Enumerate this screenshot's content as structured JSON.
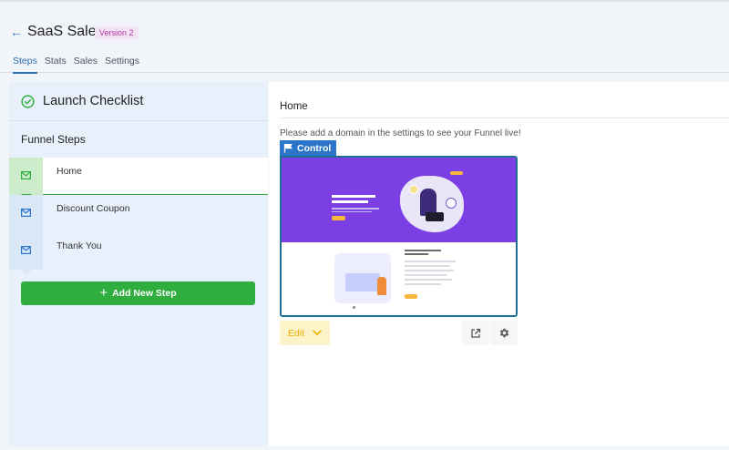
{
  "header": {
    "back_icon": "arrow-left-icon",
    "title": "SaaS Sales",
    "version_badge": "Version 2",
    "tabs": [
      {
        "label": "Steps",
        "active": true
      },
      {
        "label": "Stats",
        "active": false
      },
      {
        "label": "Sales",
        "active": false
      },
      {
        "label": "Settings",
        "active": false
      }
    ]
  },
  "sidebar": {
    "checklist_title": "Launch Checklist",
    "checklist_icon": "check-circle-icon",
    "funnel_steps_title": "Funnel Steps",
    "steps": [
      {
        "label": "Home",
        "icon": "mail-icon",
        "active": true
      },
      {
        "label": "Discount Coupon",
        "icon": "mail-icon",
        "active": false
      },
      {
        "label": "Thank You",
        "icon": "mail-icon",
        "active": false
      }
    ],
    "add_step_label": "Add New Step"
  },
  "main": {
    "title": "Home",
    "notice": "Please add a domain in the settings to see your Funnel live!",
    "control_label": "Control",
    "control_icon": "flag-icon",
    "edit_label": "Edit",
    "open_icon": "external-link-icon",
    "settings_icon": "gear-icon"
  },
  "colors": {
    "accent_blue": "#2a74c9",
    "success_green": "#2fae3f",
    "badge_purple": "#b0389f",
    "edit_yellow": "#e7b100",
    "preview_purple": "#7b3fe4"
  }
}
